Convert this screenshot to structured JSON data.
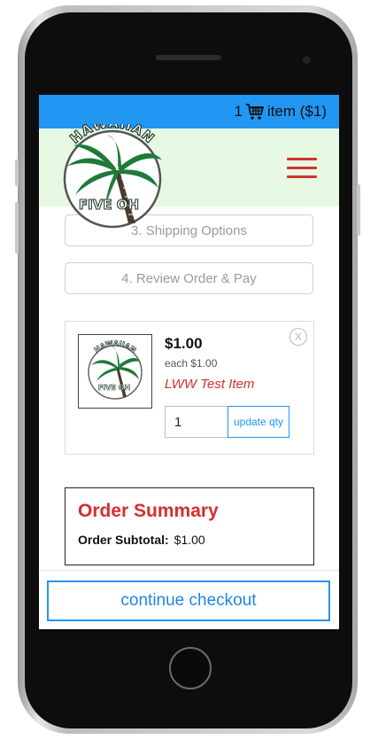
{
  "cart": {
    "count": "1",
    "label": "item ($1)"
  },
  "steps": [
    "3. Shipping Options",
    "4. Review Order & Pay"
  ],
  "item": {
    "price": "$1.00",
    "each": "each $1.00",
    "name": "LWW Test Item",
    "remove": "X",
    "qty": "1",
    "update_label": "update qty"
  },
  "summary": {
    "title": "Order Summary",
    "subtotal_label": "Order Subtotal:",
    "subtotal_value": "$1.00"
  },
  "continue_label": "continue checkout",
  "logo": {
    "top_text": "HAWAIIAN",
    "bottom_text": "FIVE OH"
  },
  "colors": {
    "accent": "#2196f3",
    "brand_red": "#d32f2f",
    "header_bg": "#e8f9e3",
    "palm_green": "#1f7a3a"
  },
  "icons": [
    "shopping-cart-icon",
    "hamburger-menu-icon",
    "close-icon"
  ]
}
